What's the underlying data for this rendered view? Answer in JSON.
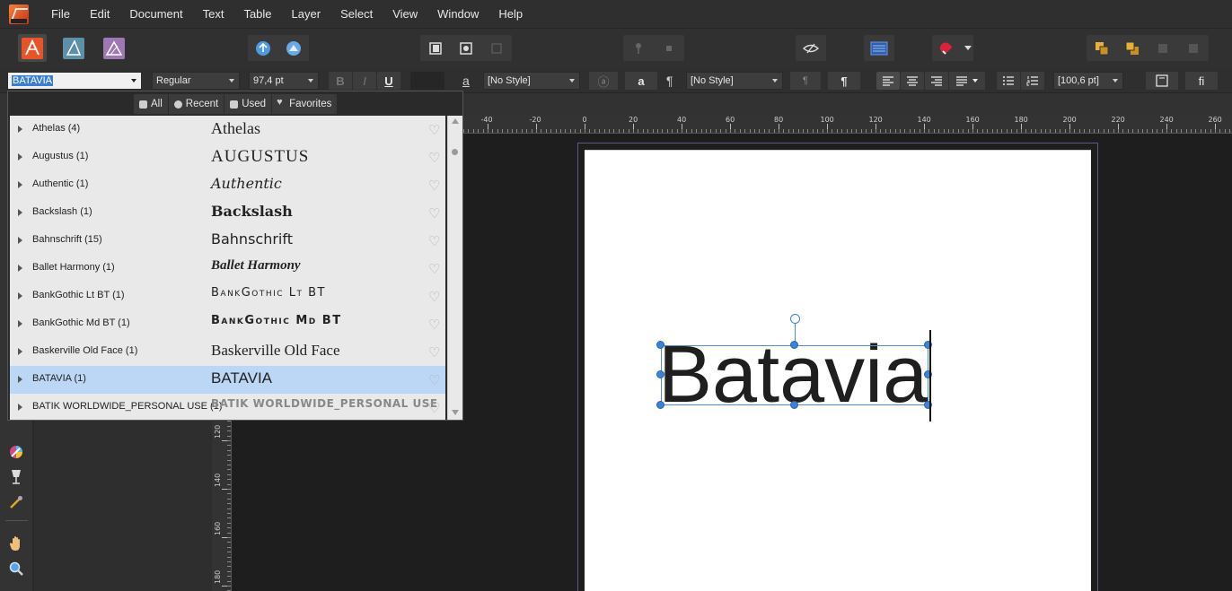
{
  "menu": [
    "File",
    "Edit",
    "Document",
    "Text",
    "Table",
    "Layer",
    "Select",
    "View",
    "Window",
    "Help"
  ],
  "context": {
    "font_family_value": "BATAVIA",
    "font_style": "Regular",
    "font_size": "97,4 pt",
    "bold_label": "B",
    "italic_label": "I",
    "underline_label": "U",
    "char_style": "[No Style]",
    "para_style": "[No Style]",
    "leading": "[100,6 pt]",
    "ligature_label": "fi",
    "char_glyph": "a",
    "para_glyph": "¶"
  },
  "font_popup": {
    "tabs": [
      {
        "label": "All",
        "icon": "all-icon"
      },
      {
        "label": "Recent",
        "icon": "recent-icon"
      },
      {
        "label": "Used",
        "icon": "used-icon"
      },
      {
        "label": "Favorites",
        "icon": "heart-icon"
      }
    ],
    "fonts": [
      {
        "name": "Athelas (4)",
        "preview": "Athelas"
      },
      {
        "name": "Augustus (1)",
        "preview": "AUGUSTUS"
      },
      {
        "name": "Authentic (1)",
        "preview": "Authentic"
      },
      {
        "name": "Backslash (1)",
        "preview": "Backslash"
      },
      {
        "name": "Bahnschrift (15)",
        "preview": "Bahnschrift"
      },
      {
        "name": "Ballet Harmony (1)",
        "preview": "Ballet Harmony"
      },
      {
        "name": "BankGothic Lt BT (1)",
        "preview": "BankGothic Lt BT"
      },
      {
        "name": "BankGothic Md BT (1)",
        "preview": "BankGothic Md BT"
      },
      {
        "name": "Baskerville Old Face (1)",
        "preview": "Baskerville Old Face"
      },
      {
        "name": "BATAVIA (1)",
        "preview": "BATAVIA"
      },
      {
        "name": "BATIK WORLDWIDE_PERSONAL USE (1)",
        "preview": "BATIK WORLDWIDE_PERSONAL USE"
      }
    ],
    "selected_index": 9
  },
  "ruler": {
    "h_labels": [
      "-40",
      "-20",
      "0",
      "20",
      "40",
      "60",
      "80",
      "100",
      "120",
      "140",
      "160",
      "180",
      "200",
      "220",
      "240",
      "260"
    ],
    "v_labels": [
      "120",
      "140",
      "160",
      "180"
    ]
  },
  "document": {
    "text": "Batavia"
  },
  "colors": {
    "accent": "#3c82d6",
    "selection": "#bcd7f5",
    "page": "#ffffff",
    "canvas": "#1e1e1e"
  }
}
